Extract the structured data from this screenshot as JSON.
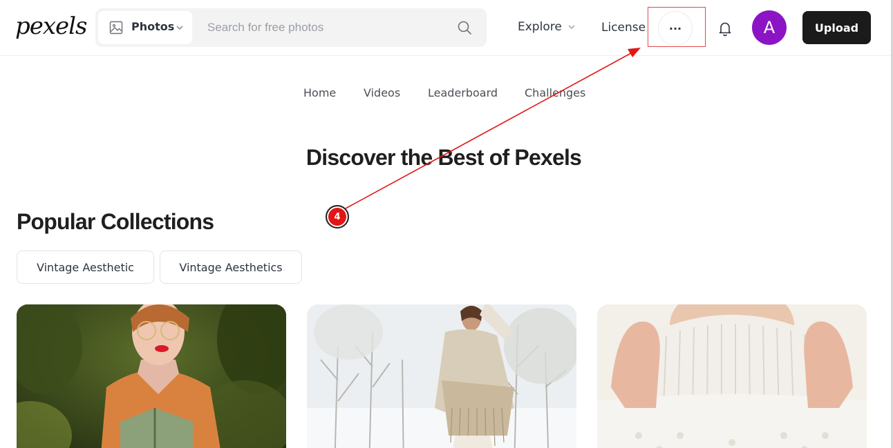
{
  "header": {
    "logo": "pexels",
    "search": {
      "type_label": "Photos",
      "placeholder": "Search for free photos",
      "value": ""
    },
    "nav": {
      "explore": "Explore",
      "license": "License",
      "more": "···"
    },
    "avatar_letter": "A",
    "upload_label": "Upload"
  },
  "subnav": {
    "items": [
      "Home",
      "Videos",
      "Leaderboard",
      "Challenges"
    ]
  },
  "main": {
    "hero_title": "Discover the Best of Pexels",
    "section_title": "Popular Collections",
    "chips": [
      "Vintage Aesthetic",
      "Vintage Aesthetics"
    ]
  },
  "annotation": {
    "step_number": "4",
    "color": "#e31515"
  },
  "colors": {
    "avatar_bg": "#8b15c5",
    "upload_bg": "#1b1b1b",
    "accent_red": "#e04848"
  },
  "icons": [
    "image-icon",
    "chevron-down-icon",
    "search-icon",
    "more-dots-icon",
    "bell-icon"
  ]
}
